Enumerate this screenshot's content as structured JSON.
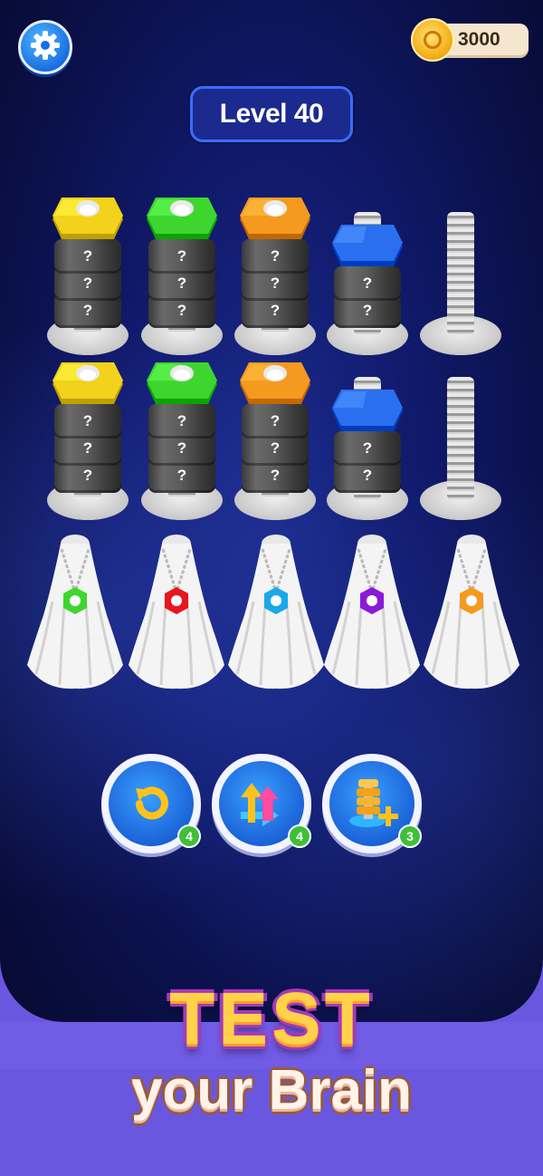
{
  "hud": {
    "coins": "3000",
    "level": "Level 40",
    "settings_icon": "gear-icon",
    "coin_icon": "coin-icon"
  },
  "board": {
    "rows": [
      [
        {
          "cap": "yellow",
          "hidden_nuts": 3
        },
        {
          "cap": "green",
          "hidden_nuts": 3
        },
        {
          "cap": "orange",
          "hidden_nuts": 3
        },
        {
          "cap": "blue",
          "hidden_nuts": 2
        },
        {
          "cap": null,
          "hidden_nuts": 0
        }
      ],
      [
        {
          "cap": "yellow",
          "hidden_nuts": 3
        },
        {
          "cap": "green",
          "hidden_nuts": 3
        },
        {
          "cap": "orange",
          "hidden_nuts": 3
        },
        {
          "cap": "blue",
          "hidden_nuts": 2
        },
        {
          "cap": null,
          "hidden_nuts": 0
        }
      ]
    ],
    "hidden_mark": "?",
    "covered_pegs": [
      "green",
      "red",
      "cyan",
      "purple",
      "orange"
    ]
  },
  "colors": {
    "yellow": "#f2d21a",
    "green": "#3ed62e",
    "orange": "#f59a1e",
    "blue": "#2a6ff0",
    "red": "#e8161e",
    "cyan": "#1aa8e8",
    "purple": "#8a1ad8"
  },
  "powerups": [
    {
      "name": "undo",
      "icon": "undo-icon",
      "count": "4"
    },
    {
      "name": "shuffle",
      "icon": "shuffle-icon",
      "count": "4"
    },
    {
      "name": "add-bolt",
      "icon": "add-bolt-icon",
      "count": "3"
    }
  ],
  "promo": {
    "line1": "TEST",
    "line2": "your Brain"
  }
}
